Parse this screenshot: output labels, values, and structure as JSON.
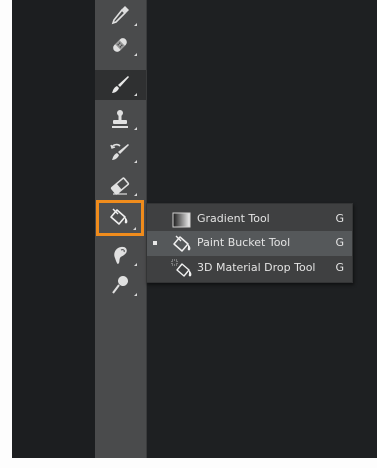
{
  "toolbar": {
    "tools": [
      {
        "icon": "eyedropper-icon"
      },
      {
        "icon": "spot-healing-brush-icon"
      },
      {
        "icon": "brush-icon"
      },
      {
        "icon": "clone-stamp-icon"
      },
      {
        "icon": "history-brush-icon"
      },
      {
        "icon": "eraser-icon"
      },
      {
        "icon": "paint-bucket-icon"
      },
      {
        "icon": "blur-icon"
      },
      {
        "icon": "dodge-icon"
      }
    ],
    "highlight_color": "#f08c1c"
  },
  "flyout": {
    "items": [
      {
        "label": "Gradient Tool",
        "shortcut": "G",
        "icon": "gradient-icon",
        "selected": false
      },
      {
        "label": "Paint Bucket Tool",
        "shortcut": "G",
        "icon": "paint-bucket-icon",
        "selected": true
      },
      {
        "label": "3D Material Drop Tool",
        "shortcut": "G",
        "icon": "3d-material-drop-icon",
        "selected": false
      }
    ]
  }
}
